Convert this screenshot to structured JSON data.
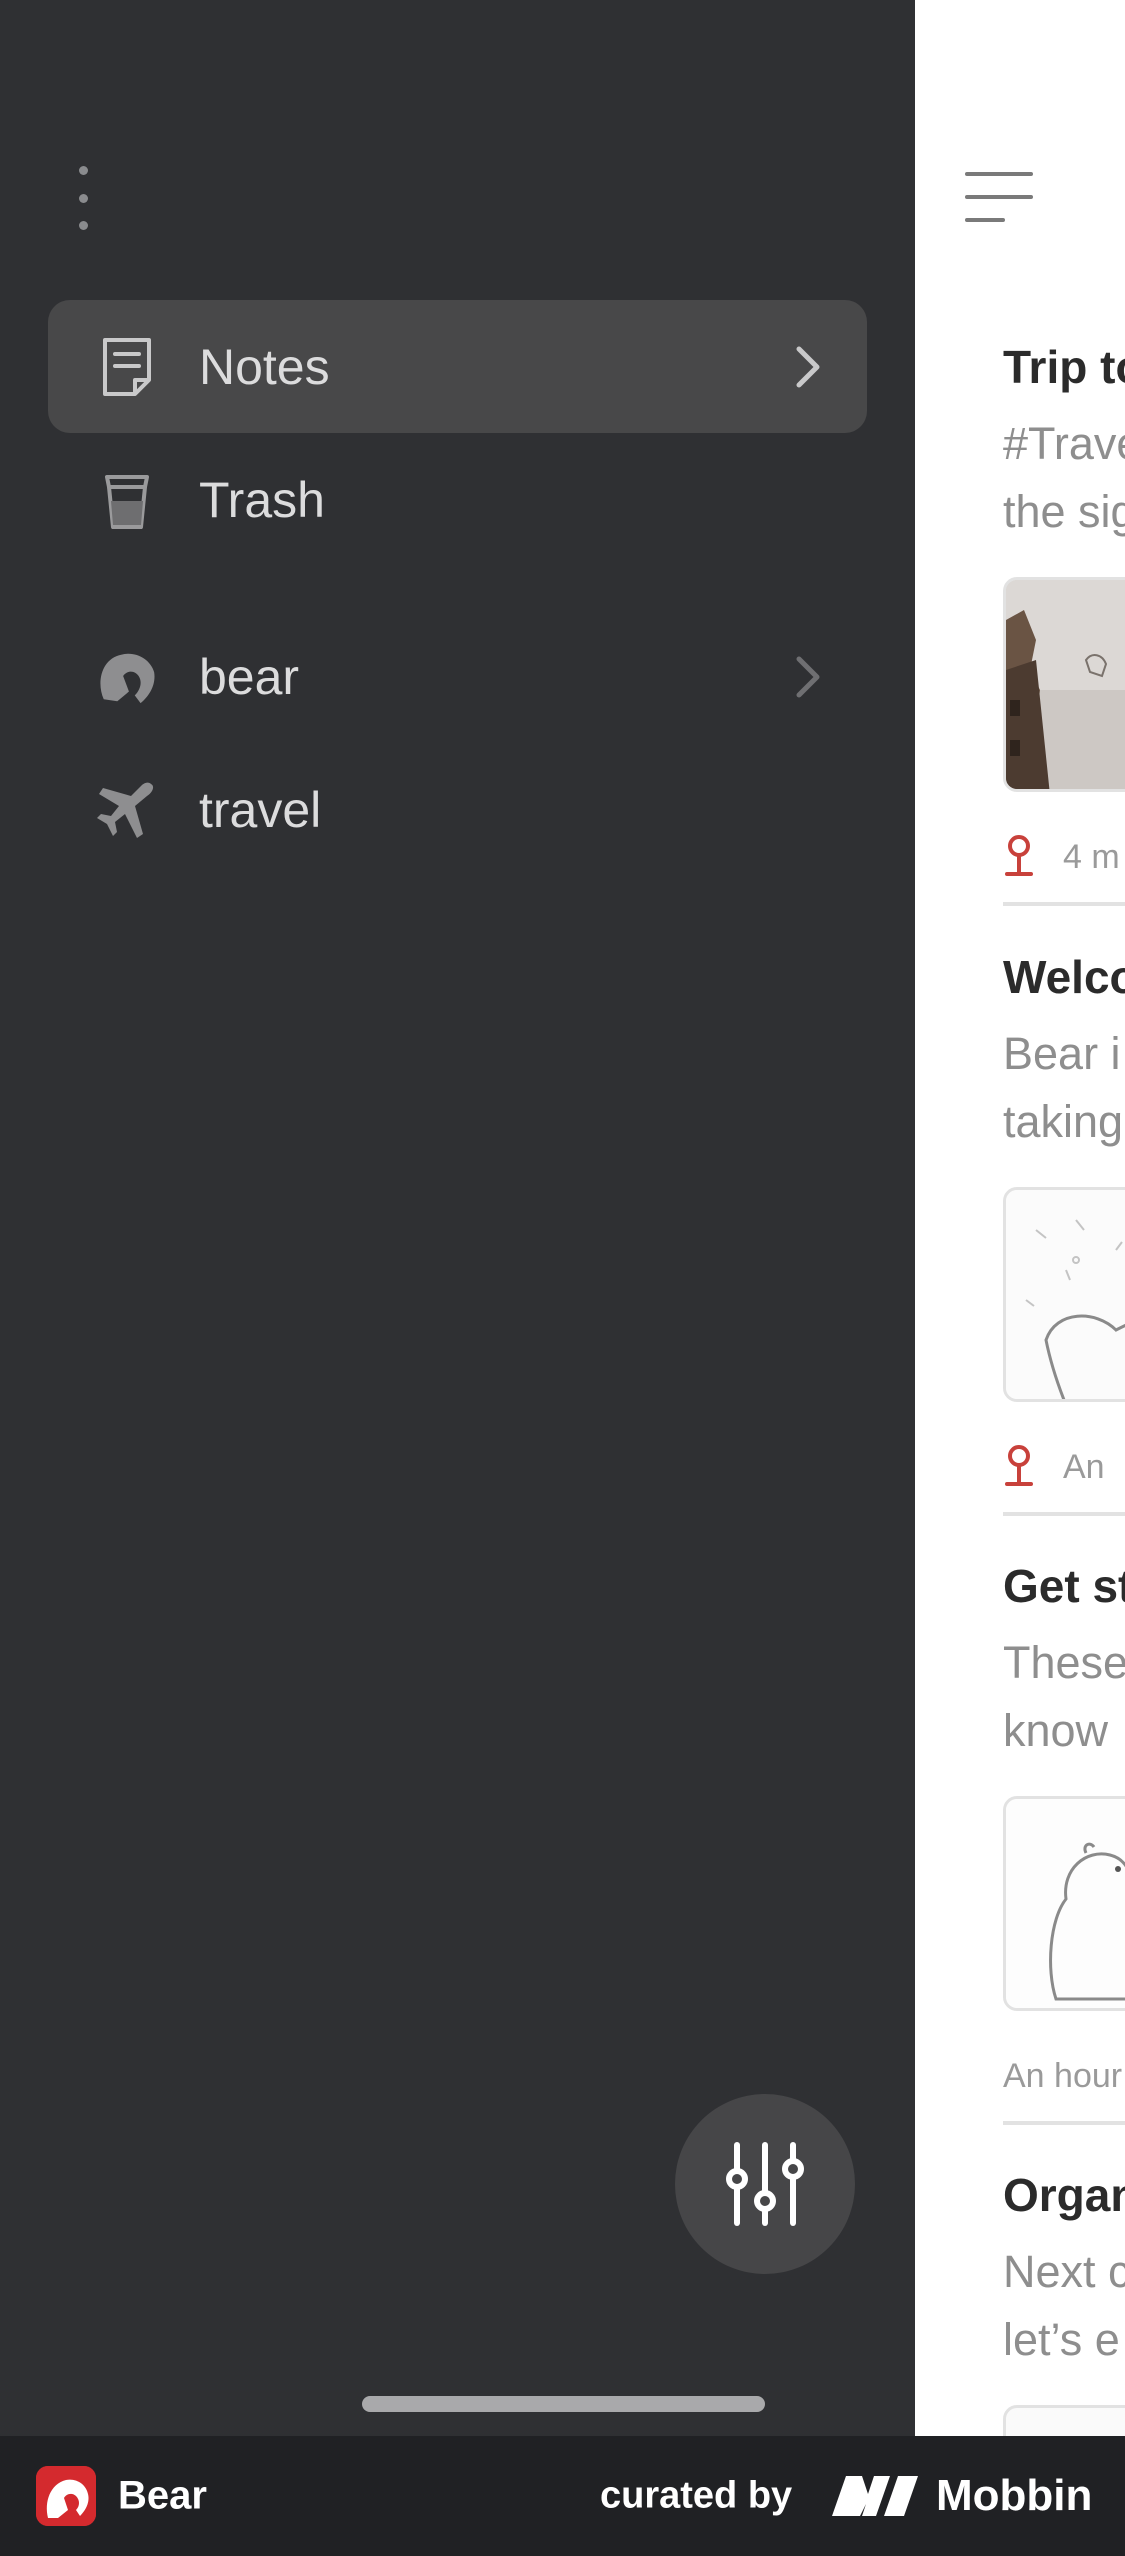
{
  "sidebar": {
    "items": [
      {
        "label": "Notes",
        "icon": "note-icon",
        "active": true,
        "has_chevron": true
      },
      {
        "label": "Trash",
        "icon": "trash-icon",
        "active": false,
        "has_chevron": false
      },
      {
        "label": "bear",
        "icon": "bear-head-icon",
        "active": false,
        "has_chevron": true
      },
      {
        "label": "travel",
        "icon": "airplane-icon",
        "active": false,
        "has_chevron": false
      }
    ]
  },
  "notes": [
    {
      "title": "Trip to",
      "line1": "#Trave",
      "line2": "the sig",
      "meta": "4 m",
      "pinned": true,
      "thumb": "photo-thumbnail"
    },
    {
      "title": "Welco",
      "line1": "Bear i",
      "line2": "taking",
      "meta": "An",
      "pinned": true,
      "thumb": "sketch-thumbnail"
    },
    {
      "title": "Get st",
      "line1": "These",
      "line2": "know",
      "meta": "An hour",
      "pinned": false,
      "thumb": "bear-sketch-thumbnail"
    },
    {
      "title": "Organ",
      "line1": "Next c",
      "line2": "let’s e",
      "meta": "",
      "pinned": false,
      "thumb": ""
    }
  ],
  "footer": {
    "app_name": "Bear",
    "curated_by": "curated by",
    "brand": "Mobbin"
  },
  "colors": {
    "sidebar_bg": "#2f3033",
    "active_item_bg": "#484849",
    "pin_red": "#c8413b",
    "footer_bg": "#202124",
    "bear_logo_red": "#d42a2e"
  }
}
